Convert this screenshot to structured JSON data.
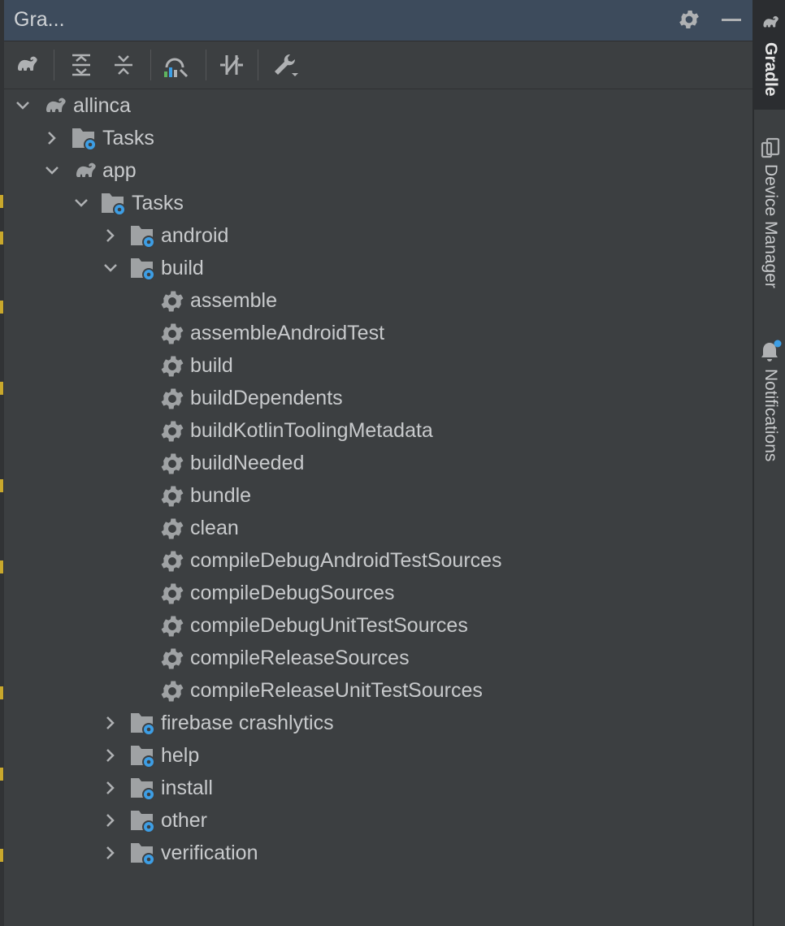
{
  "panel": {
    "title": "Gra...",
    "title_icons": [
      "gear-icon",
      "minimize-icon"
    ]
  },
  "toolbar": {
    "buttons": [
      {
        "name": "reload-all-gradle-projects-button",
        "icon": "elephant-icon"
      },
      {
        "name": "expand-all-button",
        "icon": "expand-all-icon"
      },
      {
        "name": "collapse-all-button",
        "icon": "collapse-all-icon"
      },
      {
        "name": "analyze-dependencies-button",
        "icon": "analyze-icon"
      },
      {
        "name": "toggle-offline-mode-button",
        "icon": "offline-toggle-icon"
      },
      {
        "name": "build-tool-settings-button",
        "icon": "wrench-icon"
      }
    ]
  },
  "tree": {
    "items": [
      {
        "label": "allinca",
        "type": "project",
        "state": "expanded"
      },
      {
        "label": "Tasks",
        "type": "tasks-folder",
        "state": "collapsed"
      },
      {
        "label": "app",
        "type": "project",
        "state": "expanded"
      },
      {
        "label": "Tasks",
        "type": "tasks-folder",
        "state": "expanded"
      },
      {
        "label": "android",
        "type": "tasks-folder",
        "state": "collapsed"
      },
      {
        "label": "build",
        "type": "tasks-folder",
        "state": "expanded"
      },
      {
        "label": "assemble",
        "type": "task"
      },
      {
        "label": "assembleAndroidTest",
        "type": "task"
      },
      {
        "label": "build",
        "type": "task"
      },
      {
        "label": "buildDependents",
        "type": "task"
      },
      {
        "label": "buildKotlinToolingMetadata",
        "type": "task"
      },
      {
        "label": "buildNeeded",
        "type": "task"
      },
      {
        "label": "bundle",
        "type": "task"
      },
      {
        "label": "clean",
        "type": "task"
      },
      {
        "label": "compileDebugAndroidTestSources",
        "type": "task"
      },
      {
        "label": "compileDebugSources",
        "type": "task"
      },
      {
        "label": "compileDebugUnitTestSources",
        "type": "task"
      },
      {
        "label": "compileReleaseSources",
        "type": "task"
      },
      {
        "label": "compileReleaseUnitTestSources",
        "type": "task"
      },
      {
        "label": "firebase crashlytics",
        "type": "tasks-folder",
        "state": "collapsed"
      },
      {
        "label": "help",
        "type": "tasks-folder",
        "state": "collapsed"
      },
      {
        "label": "install",
        "type": "tasks-folder",
        "state": "collapsed"
      },
      {
        "label": "other",
        "type": "tasks-folder",
        "state": "collapsed"
      },
      {
        "label": "verification",
        "type": "tasks-folder",
        "state": "collapsed"
      }
    ]
  },
  "sidebar": {
    "tabs": [
      {
        "label": "Gradle",
        "icon": "elephant-icon",
        "active": true
      },
      {
        "label": "Device Manager",
        "icon": "device-manager-icon",
        "active": false
      },
      {
        "label": "Notifications",
        "icon": "bell-icon",
        "active": false,
        "has_badge": true
      }
    ]
  },
  "colors": {
    "panel_bg": "#3c3f41",
    "title_bar_bg": "#3d4b5c",
    "text": "#c8cacc",
    "icon_gray": "#afb1b3",
    "gear_blue": "#3d9ee5"
  }
}
